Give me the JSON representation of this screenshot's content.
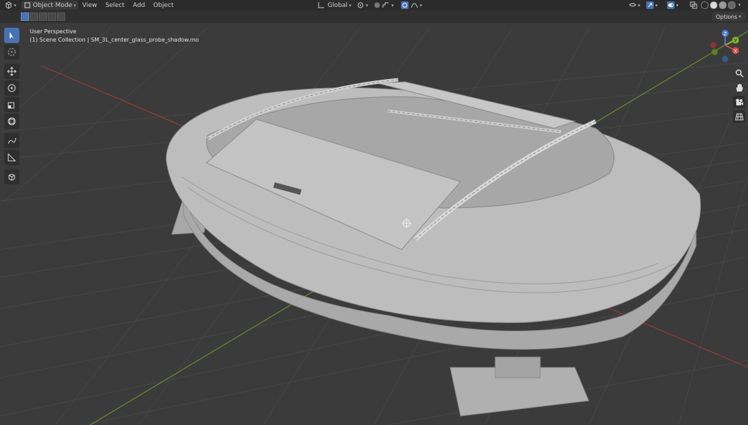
{
  "header": {
    "editor_type_icon": "3d-viewport-icon",
    "mode": "Object Mode",
    "menus": [
      "View",
      "Select",
      "Add",
      "Object"
    ],
    "transform_orientation": "Global",
    "options_label": "Options"
  },
  "viewport": {
    "view_name": "User Perspective",
    "collection_info": "(1) Scene Collection | SM_3L_center_glass_probe_shadow.mo"
  },
  "gizmo": {
    "axes": [
      "X",
      "Y",
      "Z"
    ]
  },
  "toolbar": {
    "tools": [
      "select-box",
      "cursor",
      "move",
      "rotate",
      "scale",
      "transform",
      "annotate",
      "measure",
      "add-cube"
    ]
  },
  "navigation": [
    "zoom-icon",
    "hand-pan-icon",
    "camera-icon",
    "grid-ortho-icon"
  ],
  "colors": {
    "background": "#3b3b3b",
    "header": "#2b2b2b",
    "accent": "#4772b3",
    "grid": "#454545",
    "x_axis": "#9c3a3a",
    "y_axis": "#6c8f2a",
    "model": "#b9b9b9"
  }
}
